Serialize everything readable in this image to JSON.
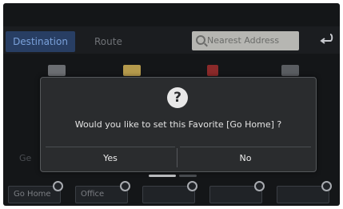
{
  "topbar": {
    "tab_destination": "Destination",
    "tab_route": "Route",
    "search_placeholder": "Nearest Address",
    "back_icon": "back-arrow-icon"
  },
  "background": {
    "left_label": "Ge"
  },
  "favorites": [
    {
      "label": "Go Home"
    },
    {
      "label": "Office"
    },
    {
      "label": ""
    },
    {
      "label": ""
    },
    {
      "label": ""
    }
  ],
  "dialog": {
    "icon": "question-icon",
    "icon_glyph": "?",
    "message": "Would you like to set this Favorite [Go Home] ?",
    "yes_label": "Yes",
    "no_label": "No"
  },
  "colors": {
    "accent_tab": "#283e63",
    "dialog_bg": "#2a2c2e"
  }
}
